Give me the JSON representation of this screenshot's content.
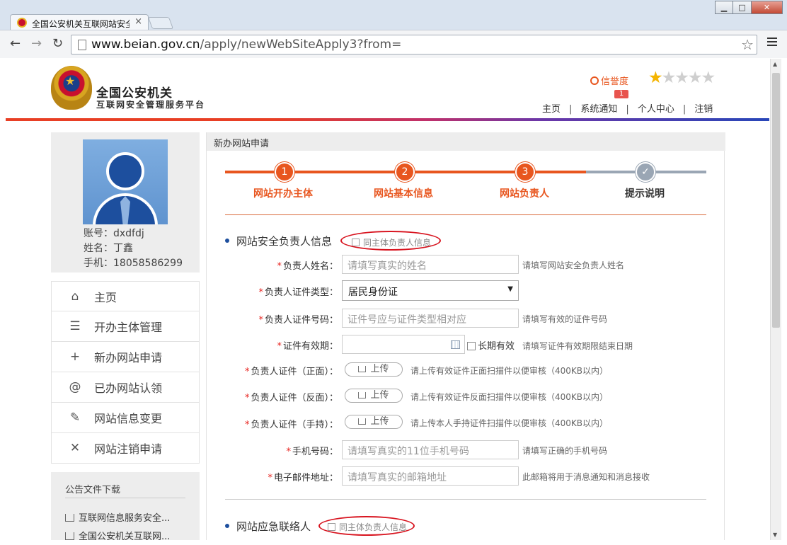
{
  "browser": {
    "tab_title": "全国公安机关互联网站安全",
    "tab_close": "×",
    "url_host": "www.beian.gov.cn",
    "url_path": "/apply/newWebSiteApply3?from=",
    "back": "←",
    "forward": "→",
    "reload": "↻",
    "bookmark": "☆",
    "win_min": "▁",
    "win_max": "□",
    "win_close": "✕"
  },
  "header": {
    "site_name_line1": "全国公安机关",
    "site_name_line2": "互联网安全管理服务平台",
    "credit_label": "信誉度",
    "credit_stars": 1,
    "credit_stars_total": 5,
    "notice_badge": "1",
    "nav": [
      "主页",
      "系统通知",
      "个人中心",
      "注销"
    ]
  },
  "profile": {
    "account": "账号：dxdfdj",
    "name": "姓名：丁鑫",
    "phone": "手机：18058586299"
  },
  "sidebar": {
    "items": [
      {
        "label": "主页",
        "icon": "home-icon",
        "glyph": "⌂"
      },
      {
        "label": "开办主体管理",
        "icon": "list-icon",
        "glyph": "☰"
      },
      {
        "label": "新办网站申请",
        "icon": "plus-icon",
        "glyph": "+"
      },
      {
        "label": "已办网站认领",
        "icon": "at-icon",
        "glyph": "@"
      },
      {
        "label": "网站信息变更",
        "icon": "edit-icon",
        "glyph": "✎"
      },
      {
        "label": "网站注销申请",
        "icon": "close-icon",
        "glyph": "✕"
      }
    ],
    "downloads_title": "公告文件下载",
    "downloads": [
      "互联网信息服务安全...",
      "全国公安机关互联网..."
    ]
  },
  "panel": {
    "title": "新办网站申请",
    "steps": [
      {
        "num": "1",
        "label": "网站开办主体"
      },
      {
        "num": "2",
        "label": "网站基本信息"
      },
      {
        "num": "3",
        "label": "网站负责人"
      },
      {
        "num": "✓",
        "label": "提示说明"
      }
    ],
    "current_step": 3
  },
  "form": {
    "section1_title": "网站安全负责人信息",
    "same_as_owner": "同主体负责人信息",
    "section2_title": "网站应急联络人",
    "required_mark": "*",
    "fields": {
      "name": {
        "label": "负责人姓名：",
        "placeholder": "请填写真实的姓名",
        "hint": "请填写网站安全负责人姓名"
      },
      "id_type": {
        "label": "负责人证件类型：",
        "value": "居民身份证",
        "caret": "▼"
      },
      "id_number": {
        "label": "负责人证件号码：",
        "placeholder": "证件号应与证件类型相对应",
        "hint": "请填写有效的证件号码"
      },
      "validity": {
        "label": "证件有效期：",
        "longterm": "长期有效",
        "hint": "请填写证件有效期限结束日期"
      },
      "id_front": {
        "label": "负责人证件（正面）：",
        "button": "上传",
        "hint": "请上传有效证件正面扫描件以便审核（400KB以内）"
      },
      "id_back": {
        "label": "负责人证件（反面）：",
        "button": "上传",
        "hint": "请上传有效证件反面扫描件以便审核（400KB以内）"
      },
      "id_hand": {
        "label": "负责人证件（手持）：",
        "button": "上传",
        "hint": "请上传本人手持证件扫描件以便审核（400KB以内）"
      },
      "mobile": {
        "label": "手机号码：",
        "placeholder": "请填写真实的11位手机号码",
        "hint": "请填写正确的手机号码"
      },
      "email": {
        "label": "电子邮件地址：",
        "placeholder": "请填写真实的邮箱地址",
        "hint": "此邮箱将用于消息通知和消息接收"
      }
    }
  }
}
